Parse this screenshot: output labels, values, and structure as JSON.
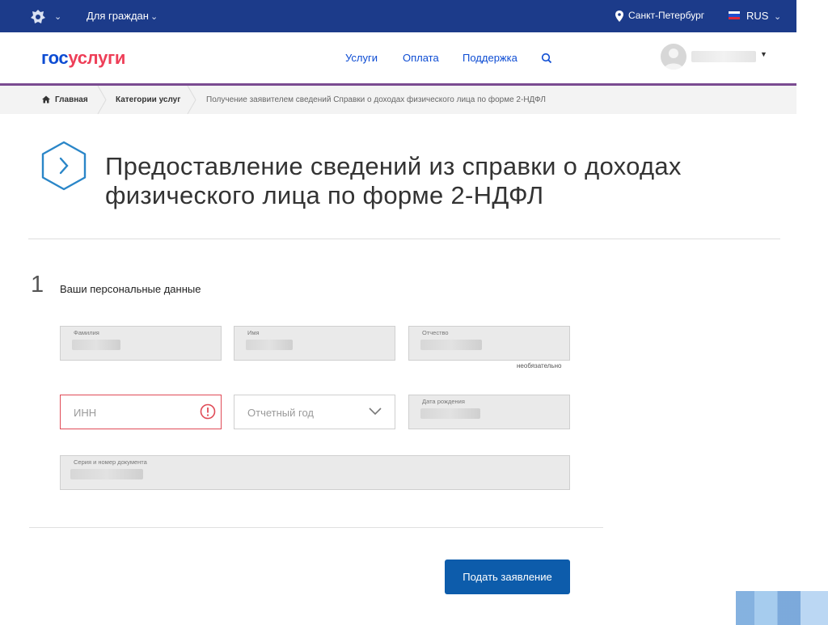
{
  "topbar": {
    "audience": "Для граждан",
    "city": "Санкт-Петербург",
    "language": "RUS"
  },
  "header": {
    "logo_part1": "гос",
    "logo_part2": "услуги",
    "nav": [
      "Услуги",
      "Оплата",
      "Поддержка"
    ]
  },
  "breadcrumb": {
    "home": "Главная",
    "category": "Категории услуг",
    "current": "Получение заявителем сведений Справки о доходах физического лица по форме 2-НДФЛ"
  },
  "page": {
    "title_line1": "Предоставление сведений из справки о доходах",
    "title_line2": "физического лица по форме 2-НДФЛ"
  },
  "step": {
    "number": "1",
    "title": "Ваши персональные данные"
  },
  "form": {
    "surname_label": "Фамилия",
    "name_label": "Имя",
    "patronymic_label": "Отчество",
    "optional_note": "необязательно",
    "inn_placeholder": "ИНН",
    "year_placeholder": "Отчетный год",
    "birthdate_label": "Дата рождения",
    "document_label": "Серия и номер документа",
    "submit_label": "Подать заявление"
  },
  "colors": {
    "topbar": "#1c3b8a",
    "brand_blue": "#0d4cd3",
    "brand_red": "#ee3f58",
    "accent_line": "#7a4b91",
    "error": "#e04b57",
    "button": "#0d5cab"
  }
}
